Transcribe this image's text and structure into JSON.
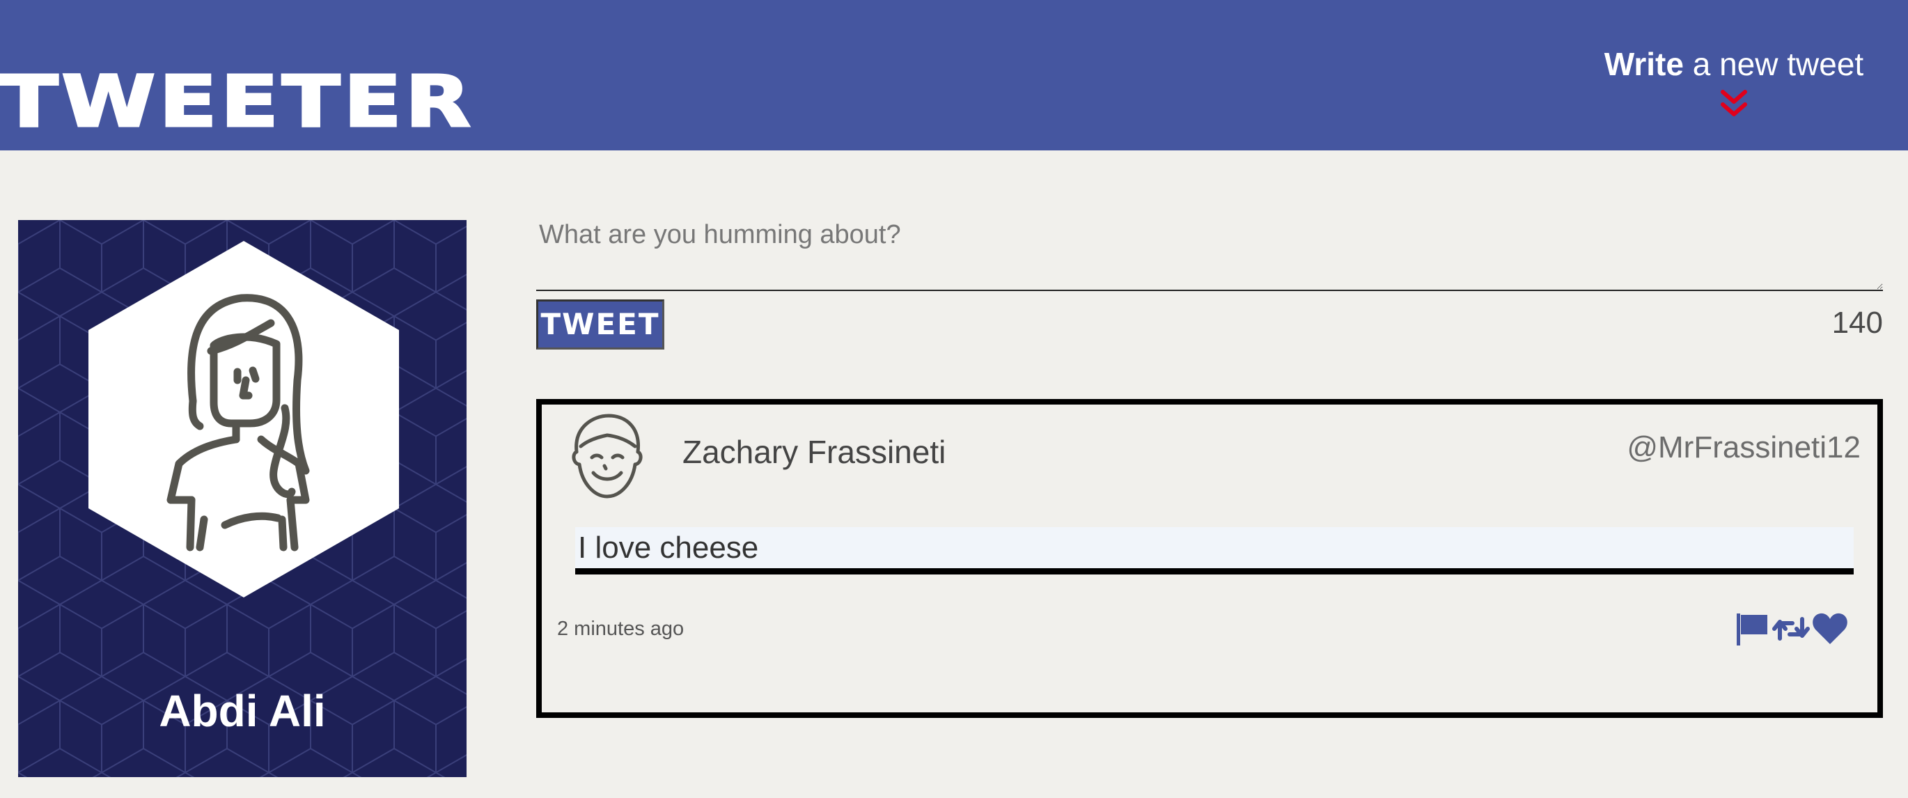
{
  "nav": {
    "brand": "TWEETER",
    "compose_bold": "Write",
    "compose_rest": " a new tweet",
    "icons": {
      "compose_toggle": "double-chevron-down-icon"
    }
  },
  "profile": {
    "name": "Abdi Ali",
    "avatar": "hexagon-woman-avatar-icon"
  },
  "composer": {
    "placeholder": "What are you humming about?",
    "value": "",
    "button_label": "TWEET",
    "counter": "140"
  },
  "tweets": [
    {
      "name": "Zachary Frassineti",
      "handle": "@MrFrassineti12",
      "content": "I love cheese",
      "time": "2 minutes ago",
      "avatar": "smiling-man-avatar-icon",
      "actions": [
        "flag-icon",
        "retweet-icon",
        "heart-icon"
      ]
    }
  ],
  "colors": {
    "nav": "#4556a0",
    "accent": "#e0001b",
    "background": "#f1f0ec",
    "profile_bg": "#1d2056",
    "icon": "#4556a0"
  }
}
